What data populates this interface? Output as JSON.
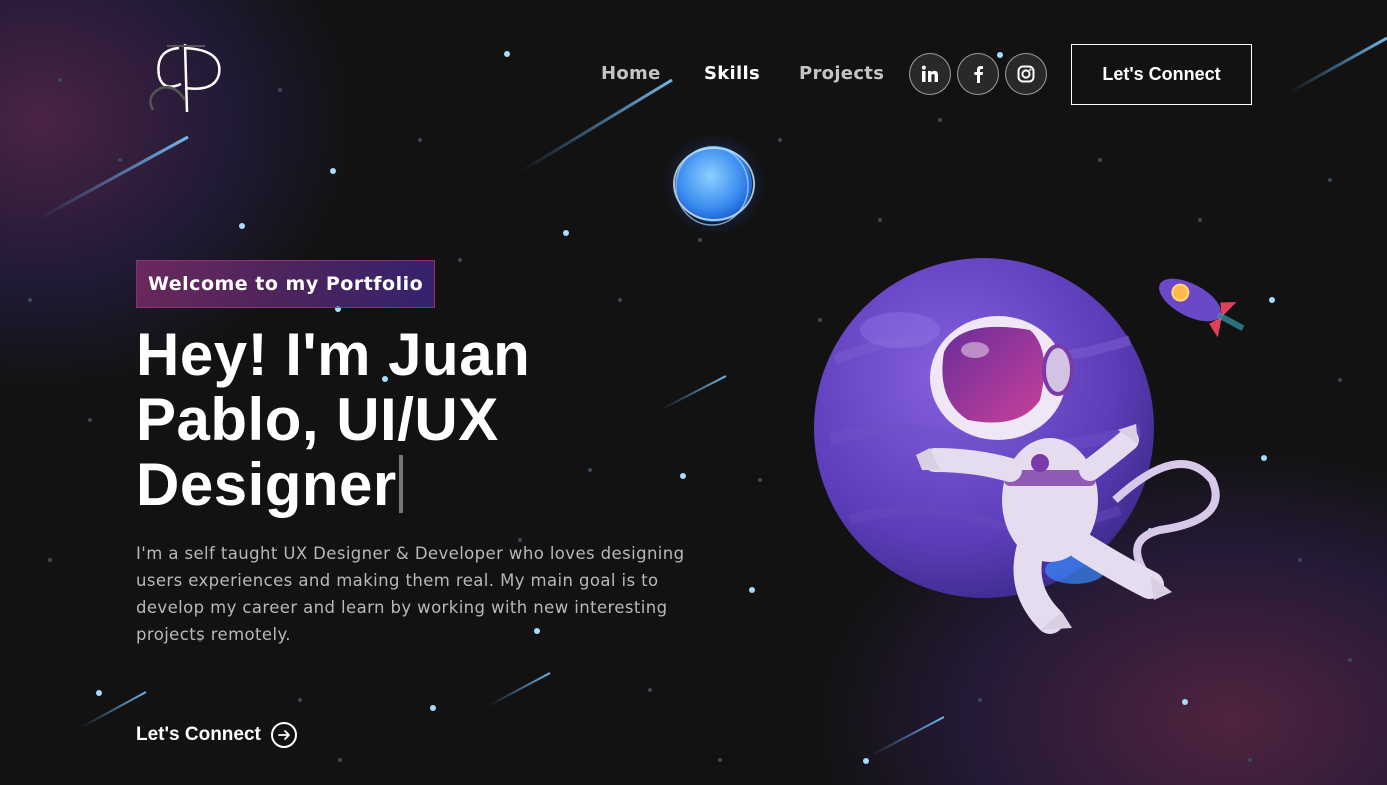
{
  "nav": {
    "links": [
      "Home",
      "Skills",
      "Projects"
    ],
    "social": [
      "linkedin-icon",
      "facebook-icon",
      "instagram-icon"
    ],
    "connect_label": "Let's Connect"
  },
  "hero": {
    "tagline": "Welcome to my Portfolio",
    "headline": "Hey! I'm Juan Pablo, UI/UX Designer",
    "description": "I'm a self taught UX Designer & Developer who loves designing users experiences and making them real. My main goal is to develop my career and learn by working with new interesting projects remotely.",
    "cta_label": "Let's Connect"
  },
  "colors": {
    "background": "#121212",
    "tagline_gradient_start": "#AA367C",
    "tagline_gradient_end": "#4A2FBD",
    "planet": "#6A48C8"
  }
}
